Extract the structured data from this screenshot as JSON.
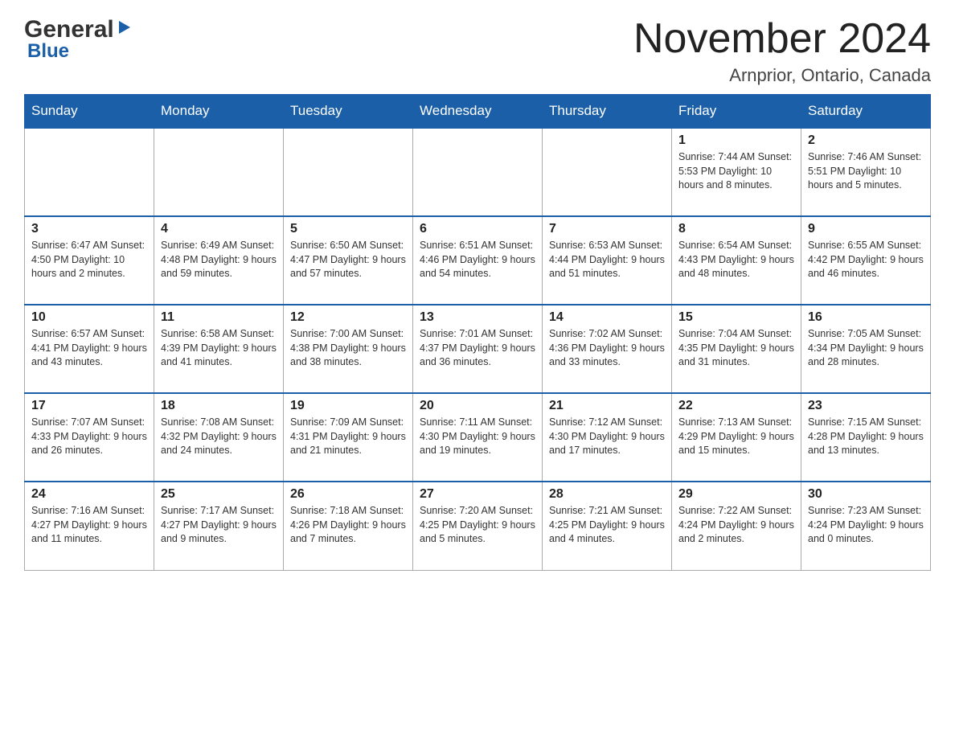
{
  "logo": {
    "general": "General",
    "blue": "Blue",
    "triangle": "▶"
  },
  "header": {
    "month_year": "November 2024",
    "location": "Arnprior, Ontario, Canada"
  },
  "weekdays": [
    "Sunday",
    "Monday",
    "Tuesday",
    "Wednesday",
    "Thursday",
    "Friday",
    "Saturday"
  ],
  "weeks": [
    [
      {
        "day": "",
        "info": ""
      },
      {
        "day": "",
        "info": ""
      },
      {
        "day": "",
        "info": ""
      },
      {
        "day": "",
        "info": ""
      },
      {
        "day": "",
        "info": ""
      },
      {
        "day": "1",
        "info": "Sunrise: 7:44 AM\nSunset: 5:53 PM\nDaylight: 10 hours and 8 minutes."
      },
      {
        "day": "2",
        "info": "Sunrise: 7:46 AM\nSunset: 5:51 PM\nDaylight: 10 hours and 5 minutes."
      }
    ],
    [
      {
        "day": "3",
        "info": "Sunrise: 6:47 AM\nSunset: 4:50 PM\nDaylight: 10 hours and 2 minutes."
      },
      {
        "day": "4",
        "info": "Sunrise: 6:49 AM\nSunset: 4:48 PM\nDaylight: 9 hours and 59 minutes."
      },
      {
        "day": "5",
        "info": "Sunrise: 6:50 AM\nSunset: 4:47 PM\nDaylight: 9 hours and 57 minutes."
      },
      {
        "day": "6",
        "info": "Sunrise: 6:51 AM\nSunset: 4:46 PM\nDaylight: 9 hours and 54 minutes."
      },
      {
        "day": "7",
        "info": "Sunrise: 6:53 AM\nSunset: 4:44 PM\nDaylight: 9 hours and 51 minutes."
      },
      {
        "day": "8",
        "info": "Sunrise: 6:54 AM\nSunset: 4:43 PM\nDaylight: 9 hours and 48 minutes."
      },
      {
        "day": "9",
        "info": "Sunrise: 6:55 AM\nSunset: 4:42 PM\nDaylight: 9 hours and 46 minutes."
      }
    ],
    [
      {
        "day": "10",
        "info": "Sunrise: 6:57 AM\nSunset: 4:41 PM\nDaylight: 9 hours and 43 minutes."
      },
      {
        "day": "11",
        "info": "Sunrise: 6:58 AM\nSunset: 4:39 PM\nDaylight: 9 hours and 41 minutes."
      },
      {
        "day": "12",
        "info": "Sunrise: 7:00 AM\nSunset: 4:38 PM\nDaylight: 9 hours and 38 minutes."
      },
      {
        "day": "13",
        "info": "Sunrise: 7:01 AM\nSunset: 4:37 PM\nDaylight: 9 hours and 36 minutes."
      },
      {
        "day": "14",
        "info": "Sunrise: 7:02 AM\nSunset: 4:36 PM\nDaylight: 9 hours and 33 minutes."
      },
      {
        "day": "15",
        "info": "Sunrise: 7:04 AM\nSunset: 4:35 PM\nDaylight: 9 hours and 31 minutes."
      },
      {
        "day": "16",
        "info": "Sunrise: 7:05 AM\nSunset: 4:34 PM\nDaylight: 9 hours and 28 minutes."
      }
    ],
    [
      {
        "day": "17",
        "info": "Sunrise: 7:07 AM\nSunset: 4:33 PM\nDaylight: 9 hours and 26 minutes."
      },
      {
        "day": "18",
        "info": "Sunrise: 7:08 AM\nSunset: 4:32 PM\nDaylight: 9 hours and 24 minutes."
      },
      {
        "day": "19",
        "info": "Sunrise: 7:09 AM\nSunset: 4:31 PM\nDaylight: 9 hours and 21 minutes."
      },
      {
        "day": "20",
        "info": "Sunrise: 7:11 AM\nSunset: 4:30 PM\nDaylight: 9 hours and 19 minutes."
      },
      {
        "day": "21",
        "info": "Sunrise: 7:12 AM\nSunset: 4:30 PM\nDaylight: 9 hours and 17 minutes."
      },
      {
        "day": "22",
        "info": "Sunrise: 7:13 AM\nSunset: 4:29 PM\nDaylight: 9 hours and 15 minutes."
      },
      {
        "day": "23",
        "info": "Sunrise: 7:15 AM\nSunset: 4:28 PM\nDaylight: 9 hours and 13 minutes."
      }
    ],
    [
      {
        "day": "24",
        "info": "Sunrise: 7:16 AM\nSunset: 4:27 PM\nDaylight: 9 hours and 11 minutes."
      },
      {
        "day": "25",
        "info": "Sunrise: 7:17 AM\nSunset: 4:27 PM\nDaylight: 9 hours and 9 minutes."
      },
      {
        "day": "26",
        "info": "Sunrise: 7:18 AM\nSunset: 4:26 PM\nDaylight: 9 hours and 7 minutes."
      },
      {
        "day": "27",
        "info": "Sunrise: 7:20 AM\nSunset: 4:25 PM\nDaylight: 9 hours and 5 minutes."
      },
      {
        "day": "28",
        "info": "Sunrise: 7:21 AM\nSunset: 4:25 PM\nDaylight: 9 hours and 4 minutes."
      },
      {
        "day": "29",
        "info": "Sunrise: 7:22 AM\nSunset: 4:24 PM\nDaylight: 9 hours and 2 minutes."
      },
      {
        "day": "30",
        "info": "Sunrise: 7:23 AM\nSunset: 4:24 PM\nDaylight: 9 hours and 0 minutes."
      }
    ]
  ]
}
